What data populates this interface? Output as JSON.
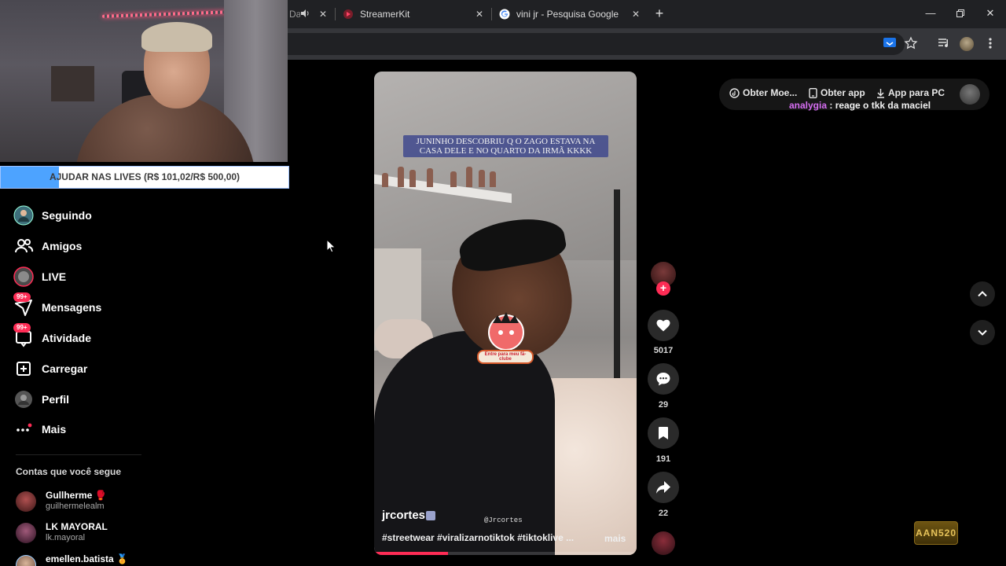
{
  "browser": {
    "tabs": [
      {
        "label": "Da",
        "has_audio": true
      },
      {
        "label": "StreamerKit"
      },
      {
        "label": "vini jr - Pesquisa Google"
      }
    ],
    "new_tab_icon": "plus-icon",
    "window_controls": [
      "minimize-icon",
      "restore-icon",
      "close-icon"
    ],
    "toolbar_icons": [
      "cast-icon",
      "star-icon",
      "media-icon",
      "profile-avatar",
      "kebab-menu-icon"
    ]
  },
  "overlay": {
    "goal_label": "AJUDAR NAS LIVES (R$ 101,02/R$ 500,00)",
    "goal_current": 101.02,
    "goal_target": 500.0,
    "accent": "#4da3ff"
  },
  "sidebar": {
    "items": [
      {
        "label": "Seguindo",
        "icon": "following-avatar-icon"
      },
      {
        "label": "Amigos",
        "icon": "friends-icon"
      },
      {
        "label": "LIVE",
        "icon": "live-icon"
      },
      {
        "label": "Mensagens",
        "icon": "messages-icon",
        "badge": "99+"
      },
      {
        "label": "Atividade",
        "icon": "activity-icon",
        "badge": "99+"
      },
      {
        "label": "Carregar",
        "icon": "upload-icon"
      },
      {
        "label": "Perfil",
        "icon": "profile-icon"
      },
      {
        "label": "Mais",
        "icon": "more-icon"
      }
    ],
    "following_title": "Contas que você segue",
    "accounts": [
      {
        "name": "Gullherme 🥊",
        "handle": "guilhermelealm"
      },
      {
        "name": "LK MAYORAL",
        "handle": "lk.mayoral"
      },
      {
        "name": "emellen.batista 🏅",
        "handle": ""
      }
    ]
  },
  "video": {
    "caption": "JUNINHO DESCOBRIU Q O ZAGO ESTAVA NA CASA DELE E NO QUARTO DA IRMÃ KKKK",
    "sticker_label": "Entre para meu fã-clube",
    "watermark": "@Jrcortes",
    "author": "jrcortes",
    "hashtags": "#streetwear #viralizarnotiktok #tiktoklive ...",
    "more_label": "mais",
    "progress": 0.28
  },
  "actions": {
    "likes": "5017",
    "comments": "29",
    "saves": "191",
    "shares": "22"
  },
  "header": {
    "coins_label": "Obter Moe...",
    "app_label": "Obter app",
    "pc_label": "App para PC"
  },
  "chat": {
    "user": "analygia",
    "message": ": reage o tkk da maciel"
  },
  "corner_logo": "AAN520",
  "colors": {
    "tiktok_red": "#fe2c55",
    "chat_user": "#d66ef2",
    "chrome_dark": "#202124"
  }
}
